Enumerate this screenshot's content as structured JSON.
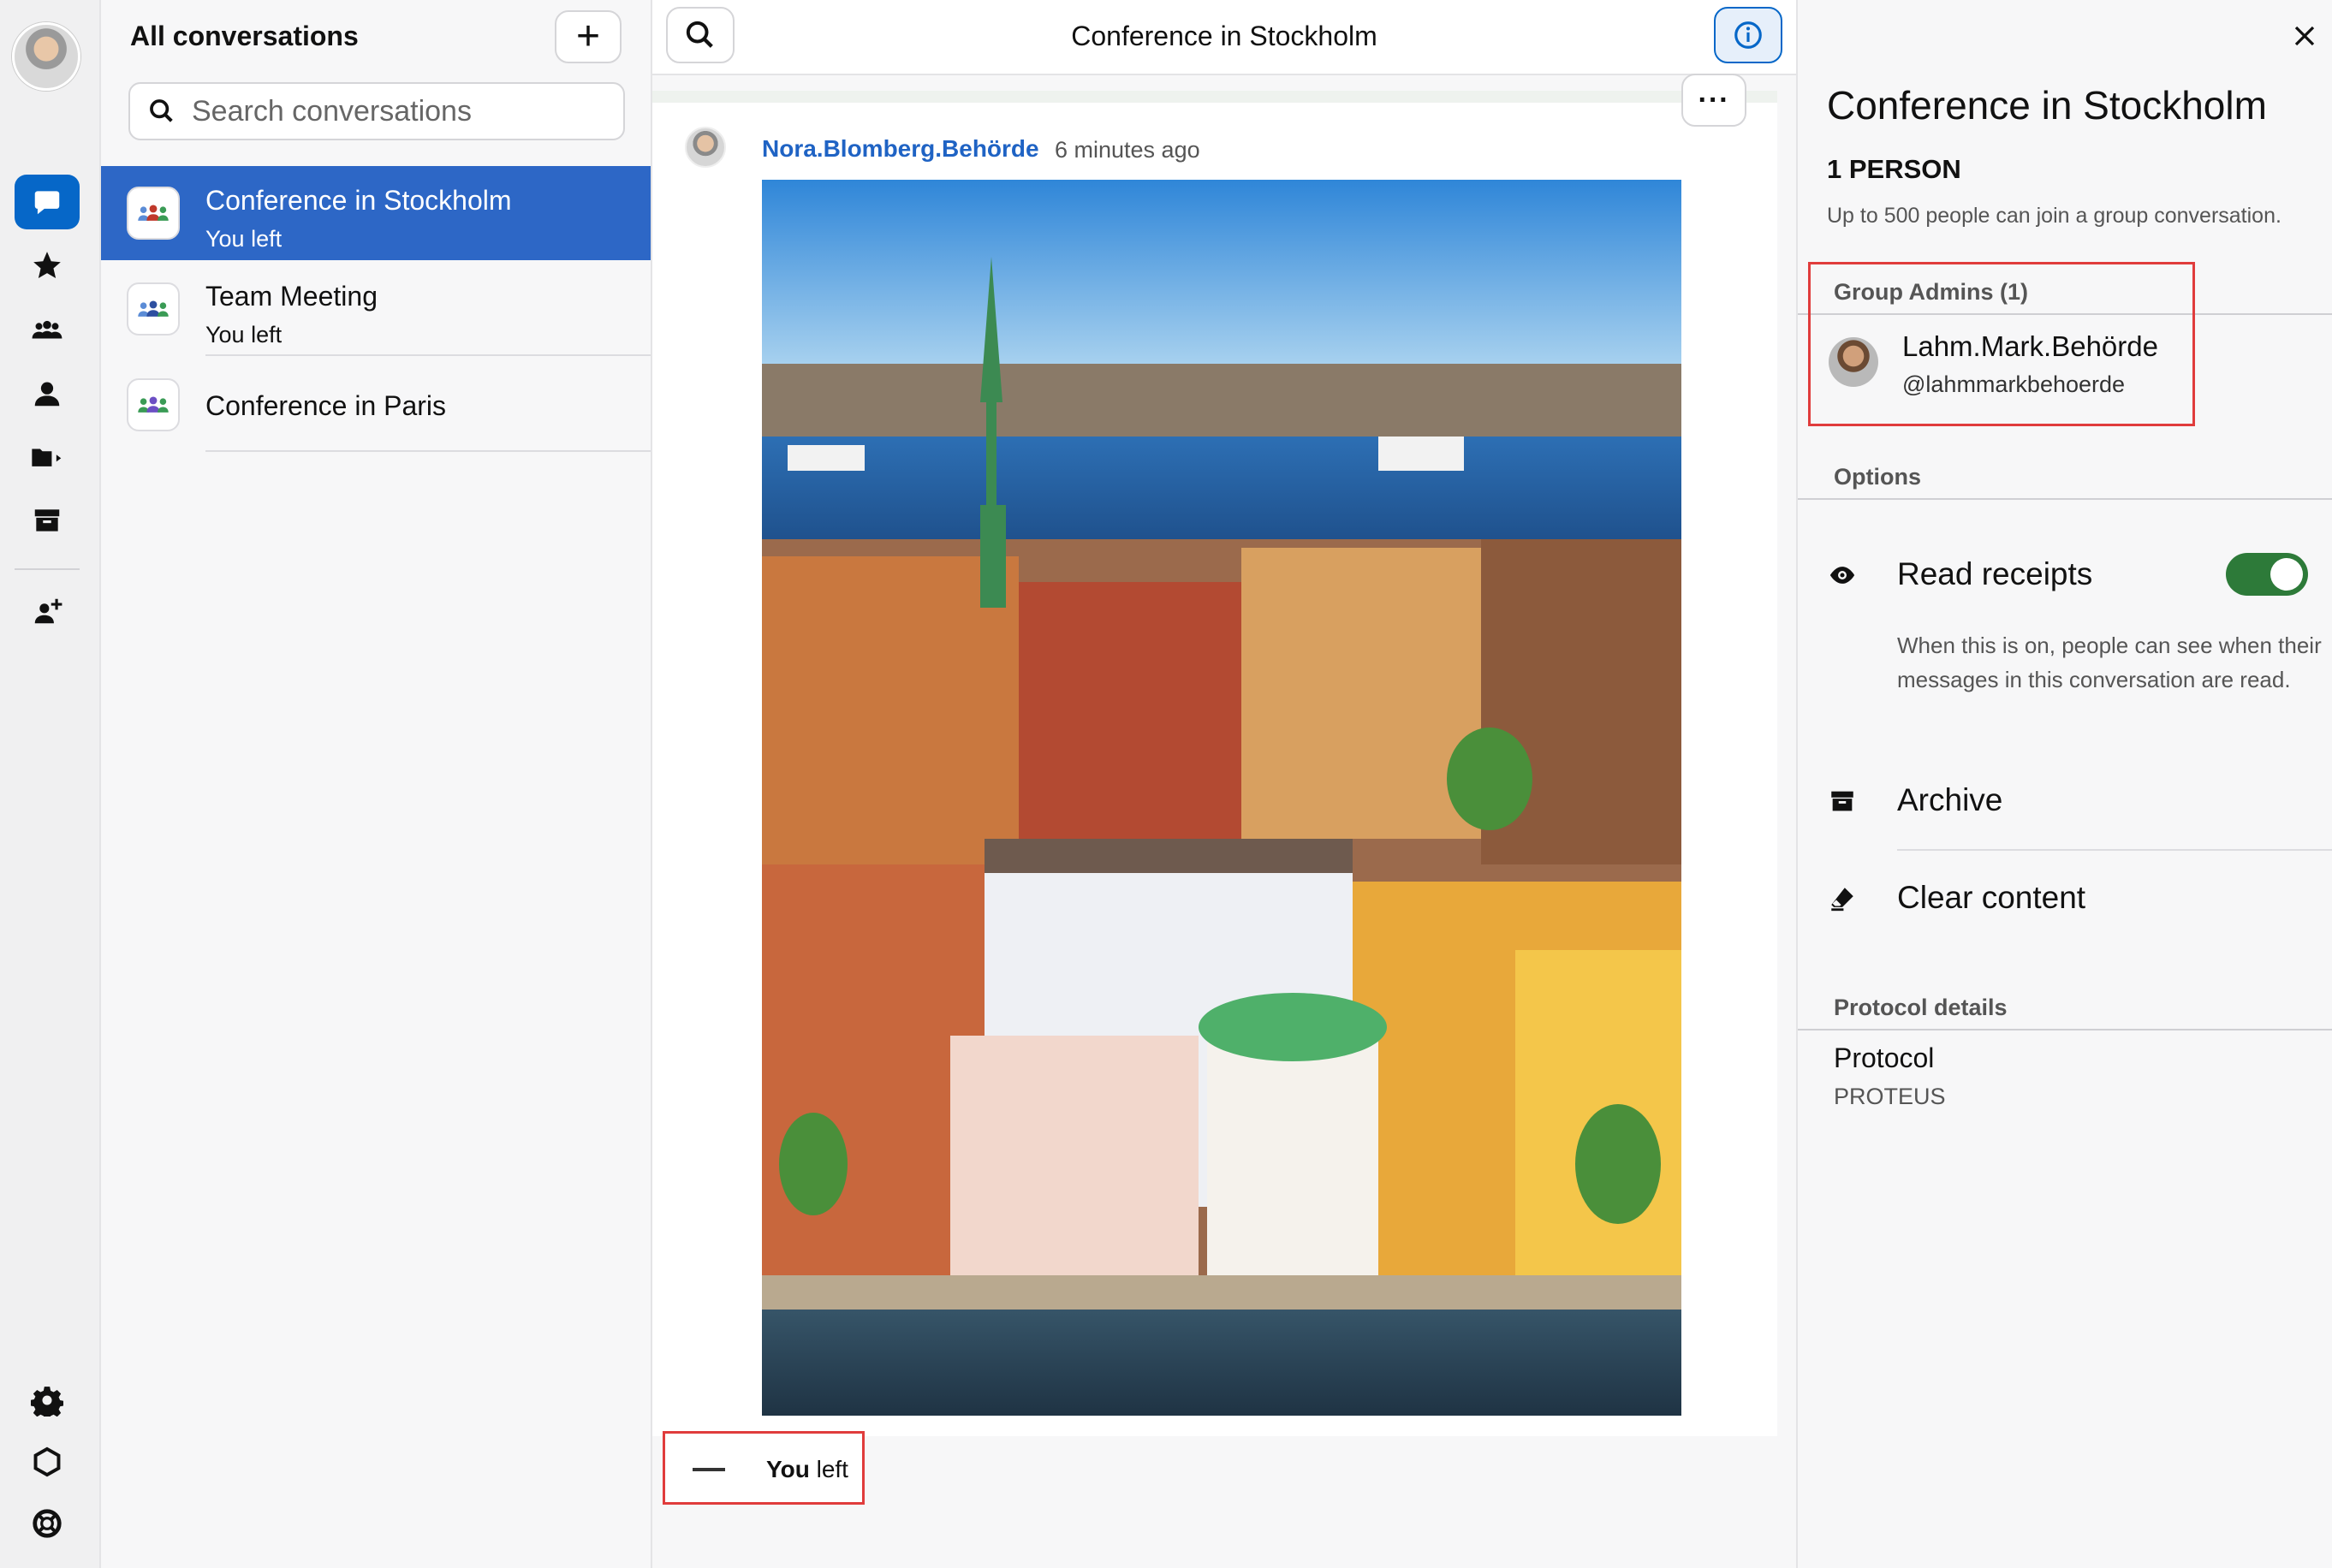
{
  "rail": {
    "items": [
      {
        "name": "conversations",
        "icon": "chat-bubble-icon",
        "active": true
      },
      {
        "name": "favorites",
        "icon": "star-icon"
      },
      {
        "name": "groups",
        "icon": "group-icon"
      },
      {
        "name": "people",
        "icon": "person-icon"
      },
      {
        "name": "folders",
        "icon": "folder-icon"
      },
      {
        "name": "archive",
        "icon": "archive-icon"
      },
      {
        "name": "connect",
        "icon": "add-person-icon"
      },
      {
        "name": "settings",
        "icon": "gear-icon"
      },
      {
        "name": "teams",
        "icon": "hexagon-icon"
      },
      {
        "name": "support",
        "icon": "lifebuoy-icon"
      }
    ]
  },
  "list": {
    "title": "All conversations",
    "new_label": "+",
    "search_placeholder": "Search conversations",
    "conversations": [
      {
        "name": "Conference in Stockholm",
        "sub": "You left",
        "active": true
      },
      {
        "name": "Team Meeting",
        "sub": "You left"
      },
      {
        "name": "Conference in Paris",
        "sub": ""
      }
    ]
  },
  "chat": {
    "title": "Conference in Stockholm",
    "more_label": "···",
    "message": {
      "sender": "Nora.Blomberg.Behörde",
      "time": "6 minutes ago"
    },
    "system": {
      "you": "You",
      "text": " left"
    }
  },
  "panel": {
    "title": "Conference in Stockholm",
    "count": "1 PERSON",
    "note": "Up to 500 people can join a group conversation.",
    "admins_header": "Group Admins (1)",
    "admin": {
      "name": "Lahm.Mark.Behörde",
      "handle": "@lahmmarkbehoerde"
    },
    "options_header": "Options",
    "read_receipts": {
      "label": "Read receipts",
      "enabled": true,
      "description": "When this is on, people can see when their messages in this conversation are read."
    },
    "archive_label": "Archive",
    "clear_label": "Clear content",
    "protocol_header": "Protocol details",
    "protocol_label": "Protocol",
    "protocol_value": "PROTEUS"
  },
  "colors": {
    "accent": "#0667c8",
    "active_row": "#2d67c6",
    "sender": "#1f63c4",
    "toggle_on": "#2d7a39",
    "highlight": "#e03c3c"
  }
}
